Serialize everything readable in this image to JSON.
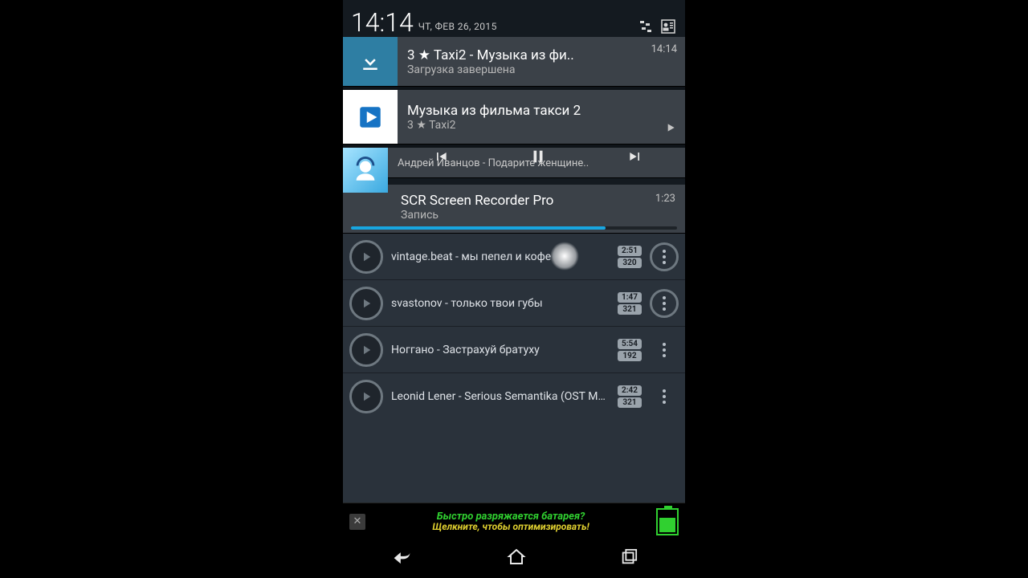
{
  "status": {
    "clock": "14:14",
    "date": "ЧТ, ФЕВ 26, 2015"
  },
  "notifications": {
    "download": {
      "title": "3  ★ Taxi2 - Музыка из фи..",
      "sub": "Загрузка завершена",
      "time": "14:14"
    },
    "nowplaying": {
      "title": "Музыка из фильма такси 2",
      "sub": "3  ★ Taxi2"
    },
    "media": {
      "track": "Андрей Иванцов - Подарите женщине.."
    },
    "scr": {
      "title": "SCR Screen Recorder Pro",
      "sub": "Запись",
      "time": "1:23"
    }
  },
  "tracks": [
    {
      "title": "vintage.beat  - мы пепел и кофе",
      "dur": "2:51",
      "bitrate": "320"
    },
    {
      "title": "svastonov - только твои губы",
      "dur": "1:47",
      "bitrate": "321"
    },
    {
      "title": "Ноггано - Застрахуй братуху",
      "dur": "5:54",
      "bitrate": "192"
    },
    {
      "title": "Leonid Lener - Serious Semantika (OST Молодежка)",
      "dur": "2:42",
      "bitrate": "321"
    }
  ],
  "ad": {
    "line1": "Быстро разряжается батарея?",
    "line2": "Щелкните, чтобы оптимизировать!"
  }
}
